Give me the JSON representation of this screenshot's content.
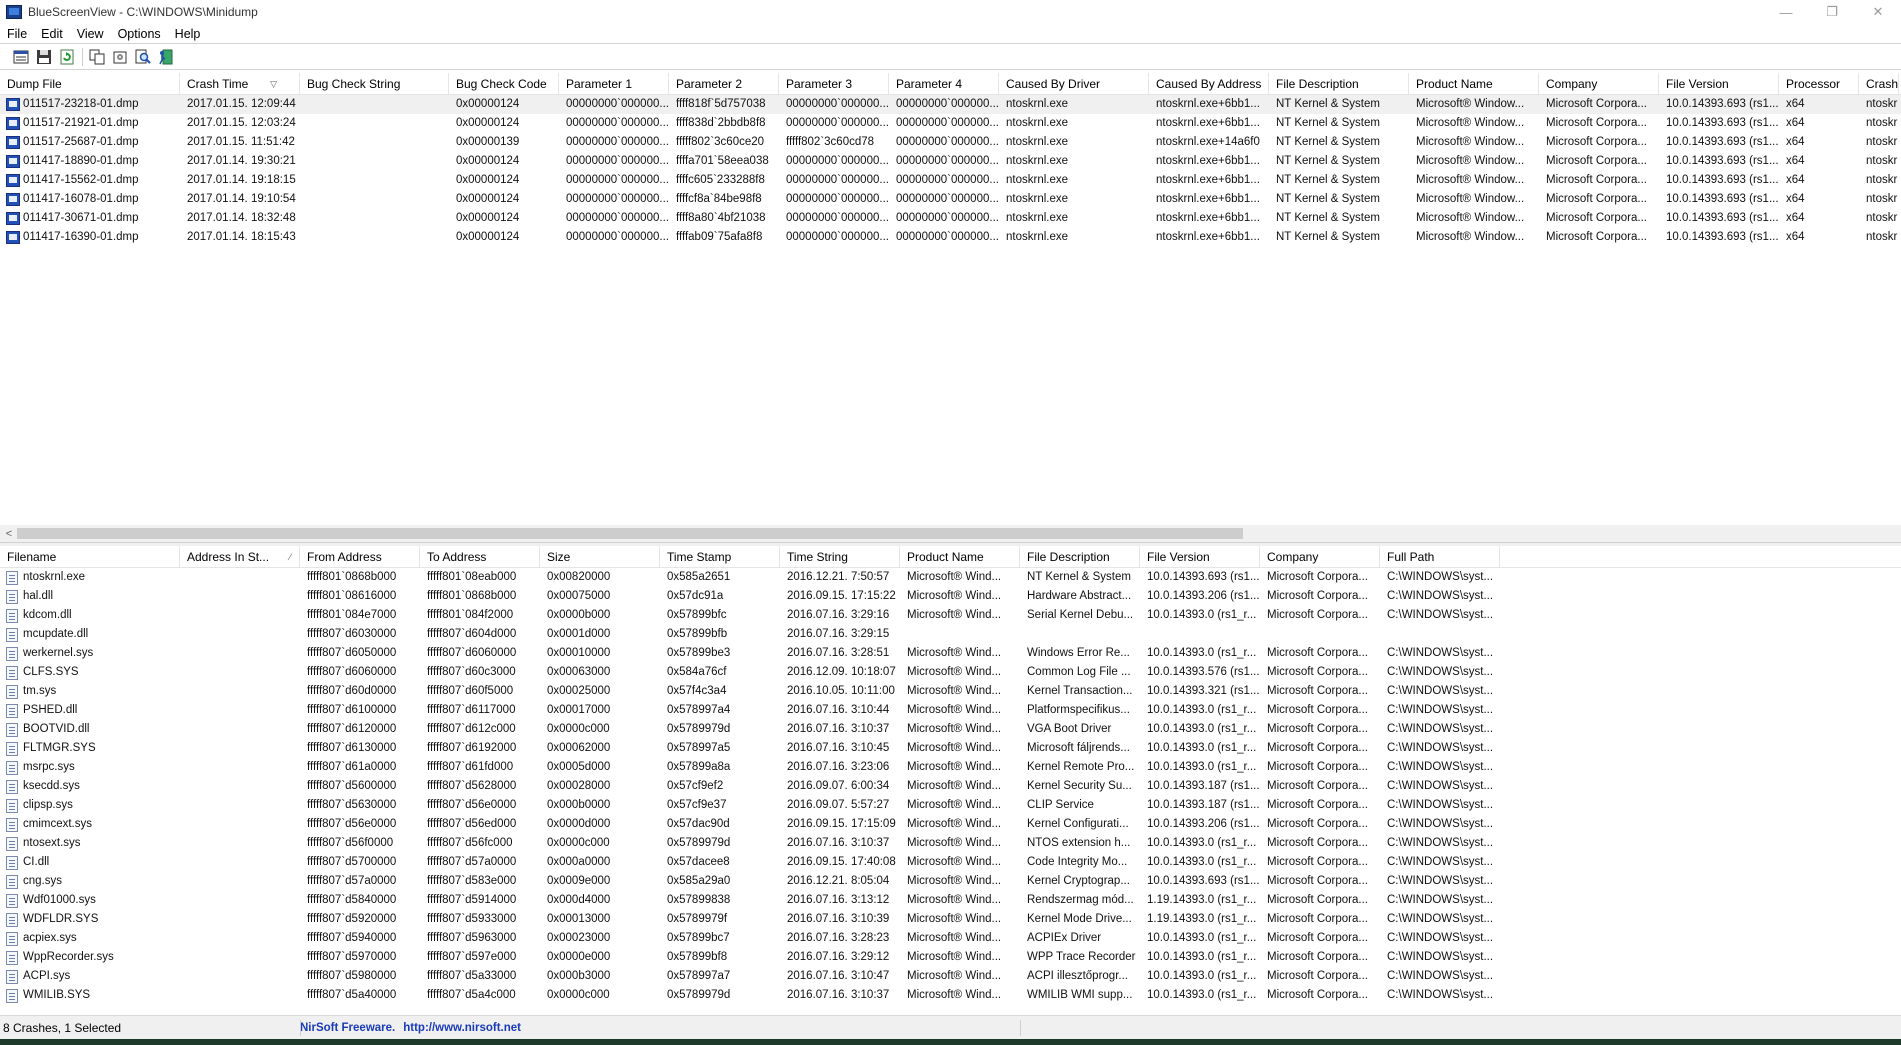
{
  "window": {
    "title": "BlueScreenView  -  C:\\WINDOWS\\Minidump",
    "controls": [
      "—",
      "❐",
      "✕"
    ]
  },
  "menu": [
    "File",
    "Edit",
    "View",
    "Options",
    "Help"
  ],
  "toolbar_icons": [
    "properties-icon",
    "save-icon",
    "refresh-icon",
    "copy-icon",
    "advanced-options-icon",
    "find-icon",
    "exit-icon"
  ],
  "top_table": {
    "columns": [
      "Dump File",
      "Crash Time",
      "Bug Check String",
      "Bug Check Code",
      "Parameter 1",
      "Parameter 2",
      "Parameter 3",
      "Parameter 4",
      "Caused By Driver",
      "Caused By Address",
      "File Description",
      "Product Name",
      "Company",
      "File Version",
      "Processor",
      "Crash"
    ],
    "rows": [
      [
        "011517-23218-01.dmp",
        "2017.01.15. 12:09:44",
        "",
        "0x00000124",
        "00000000`000000...",
        "ffff818f`5d757038",
        "00000000`000000...",
        "00000000`000000...",
        "ntoskrnl.exe",
        "ntoskrnl.exe+6bb1...",
        "NT Kernel & System",
        "Microsoft® Window...",
        "Microsoft Corpora...",
        "10.0.14393.693 (rs1...",
        "x64",
        "ntoskr"
      ],
      [
        "011517-21921-01.dmp",
        "2017.01.15. 12:03:24",
        "",
        "0x00000124",
        "00000000`000000...",
        "ffff838d`2bbdb8f8",
        "00000000`000000...",
        "00000000`000000...",
        "ntoskrnl.exe",
        "ntoskrnl.exe+6bb1...",
        "NT Kernel & System",
        "Microsoft® Window...",
        "Microsoft Corpora...",
        "10.0.14393.693 (rs1...",
        "x64",
        "ntoskr"
      ],
      [
        "011517-25687-01.dmp",
        "2017.01.15. 11:51:42",
        "",
        "0x00000139",
        "00000000`000000...",
        "fffff802`3c60ce20",
        "fffff802`3c60cd78",
        "00000000`000000...",
        "ntoskrnl.exe",
        "ntoskrnl.exe+14a6f0",
        "NT Kernel & System",
        "Microsoft® Window...",
        "Microsoft Corpora...",
        "10.0.14393.693 (rs1...",
        "x64",
        "ntoskr"
      ],
      [
        "011417-18890-01.dmp",
        "2017.01.14. 19:30:21",
        "",
        "0x00000124",
        "00000000`000000...",
        "ffffa701`58eea038",
        "00000000`000000...",
        "00000000`000000...",
        "ntoskrnl.exe",
        "ntoskrnl.exe+6bb1...",
        "NT Kernel & System",
        "Microsoft® Window...",
        "Microsoft Corpora...",
        "10.0.14393.693 (rs1...",
        "x64",
        "ntoskr"
      ],
      [
        "011417-15562-01.dmp",
        "2017.01.14. 19:18:15",
        "",
        "0x00000124",
        "00000000`000000...",
        "ffffc605`233288f8",
        "00000000`000000...",
        "00000000`000000...",
        "ntoskrnl.exe",
        "ntoskrnl.exe+6bb1...",
        "NT Kernel & System",
        "Microsoft® Window...",
        "Microsoft Corpora...",
        "10.0.14393.693 (rs1...",
        "x64",
        "ntoskr"
      ],
      [
        "011417-16078-01.dmp",
        "2017.01.14. 19:10:54",
        "",
        "0x00000124",
        "00000000`000000...",
        "ffffcf8a`84be98f8",
        "00000000`000000...",
        "00000000`000000...",
        "ntoskrnl.exe",
        "ntoskrnl.exe+6bb1...",
        "NT Kernel & System",
        "Microsoft® Window...",
        "Microsoft Corpora...",
        "10.0.14393.693 (rs1...",
        "x64",
        "ntoskr"
      ],
      [
        "011417-30671-01.dmp",
        "2017.01.14. 18:32:48",
        "",
        "0x00000124",
        "00000000`000000...",
        "ffff8a80`4bf21038",
        "00000000`000000...",
        "00000000`000000...",
        "ntoskrnl.exe",
        "ntoskrnl.exe+6bb1...",
        "NT Kernel & System",
        "Microsoft® Window...",
        "Microsoft Corpora...",
        "10.0.14393.693 (rs1...",
        "x64",
        "ntoskr"
      ],
      [
        "011417-16390-01.dmp",
        "2017.01.14. 18:15:43",
        "",
        "0x00000124",
        "00000000`000000...",
        "ffffab09`75afa8f8",
        "00000000`000000...",
        "00000000`000000...",
        "ntoskrnl.exe",
        "ntoskrnl.exe+6bb1...",
        "NT Kernel & System",
        "Microsoft® Window...",
        "Microsoft Corpora...",
        "10.0.14393.693 (rs1...",
        "x64",
        "ntoskr"
      ]
    ]
  },
  "bottom_table": {
    "columns": [
      "Filename",
      "Address In St...",
      "From Address",
      "To Address",
      "Size",
      "Time Stamp",
      "Time String",
      "Product Name",
      "File Description",
      "File Version",
      "Company",
      "Full Path"
    ],
    "rows": [
      [
        "ntoskrnl.exe",
        "",
        "fffff801`0868b000",
        "fffff801`08eab000",
        "0x00820000",
        "0x585a2651",
        "2016.12.21. 7:50:57",
        "Microsoft® Wind...",
        "NT Kernel & System",
        "10.0.14393.693 (rs1...",
        "Microsoft Corpora...",
        "C:\\WINDOWS\\syst..."
      ],
      [
        "hal.dll",
        "",
        "fffff801`08616000",
        "fffff801`0868b000",
        "0x00075000",
        "0x57dc91a",
        "2016.09.15. 17:15:22",
        "Microsoft® Wind...",
        "Hardware Abstract...",
        "10.0.14393.206 (rs1...",
        "Microsoft Corpora...",
        "C:\\WINDOWS\\syst..."
      ],
      [
        "kdcom.dll",
        "",
        "fffff801`084e7000",
        "fffff801`084f2000",
        "0x0000b000",
        "0x57899bfc",
        "2016.07.16. 3:29:16",
        "Microsoft® Wind...",
        "Serial Kernel Debu...",
        "10.0.14393.0 (rs1_r...",
        "Microsoft Corpora...",
        "C:\\WINDOWS\\syst..."
      ],
      [
        "mcupdate.dll",
        "",
        "fffff807`d6030000",
        "fffff807`d604d000",
        "0x0001d000",
        "0x57899bfb",
        "2016.07.16. 3:29:15",
        "",
        "",
        "",
        "",
        ""
      ],
      [
        "werkernel.sys",
        "",
        "fffff807`d6050000",
        "fffff807`d6060000",
        "0x00010000",
        "0x57899be3",
        "2016.07.16. 3:28:51",
        "Microsoft® Wind...",
        "Windows Error Re...",
        "10.0.14393.0 (rs1_r...",
        "Microsoft Corpora...",
        "C:\\WINDOWS\\syst..."
      ],
      [
        "CLFS.SYS",
        "",
        "fffff807`d6060000",
        "fffff807`d60c3000",
        "0x00063000",
        "0x584a76cf",
        "2016.12.09. 10:18:07",
        "Microsoft® Wind...",
        "Common Log File ...",
        "10.0.14393.576 (rs1...",
        "Microsoft Corpora...",
        "C:\\WINDOWS\\syst..."
      ],
      [
        "tm.sys",
        "",
        "fffff807`d60d0000",
        "fffff807`d60f5000",
        "0x00025000",
        "0x57f4c3a4",
        "2016.10.05. 10:11:00",
        "Microsoft® Wind...",
        "Kernel Transaction...",
        "10.0.14393.321 (rs1...",
        "Microsoft Corpora...",
        "C:\\WINDOWS\\syst..."
      ],
      [
        "PSHED.dll",
        "",
        "fffff807`d6100000",
        "fffff807`d6117000",
        "0x00017000",
        "0x578997a4",
        "2016.07.16. 3:10:44",
        "Microsoft® Wind...",
        "Platformspecifikus...",
        "10.0.14393.0 (rs1_r...",
        "Microsoft Corpora...",
        "C:\\WINDOWS\\syst..."
      ],
      [
        "BOOTVID.dll",
        "",
        "fffff807`d6120000",
        "fffff807`d612c000",
        "0x0000c000",
        "0x5789979d",
        "2016.07.16. 3:10:37",
        "Microsoft® Wind...",
        "VGA Boot Driver",
        "10.0.14393.0 (rs1_r...",
        "Microsoft Corpora...",
        "C:\\WINDOWS\\syst..."
      ],
      [
        "FLTMGR.SYS",
        "",
        "fffff807`d6130000",
        "fffff807`d6192000",
        "0x00062000",
        "0x578997a5",
        "2016.07.16. 3:10:45",
        "Microsoft® Wind...",
        "Microsoft fáljrends...",
        "10.0.14393.0 (rs1_r...",
        "Microsoft Corpora...",
        "C:\\WINDOWS\\syst..."
      ],
      [
        "msrpc.sys",
        "",
        "fffff807`d61a0000",
        "fffff807`d61fd000",
        "0x0005d000",
        "0x57899a8a",
        "2016.07.16. 3:23:06",
        "Microsoft® Wind...",
        "Kernel Remote Pro...",
        "10.0.14393.0 (rs1_r...",
        "Microsoft Corpora...",
        "C:\\WINDOWS\\syst..."
      ],
      [
        "ksecdd.sys",
        "",
        "fffff807`d5600000",
        "fffff807`d5628000",
        "0x00028000",
        "0x57cf9ef2",
        "2016.09.07. 6:00:34",
        "Microsoft® Wind...",
        "Kernel Security Su...",
        "10.0.14393.187 (rs1...",
        "Microsoft Corpora...",
        "C:\\WINDOWS\\syst..."
      ],
      [
        "clipsp.sys",
        "",
        "fffff807`d5630000",
        "fffff807`d56e0000",
        "0x000b0000",
        "0x57cf9e37",
        "2016.09.07. 5:57:27",
        "Microsoft® Wind...",
        "CLIP Service",
        "10.0.14393.187 (rs1...",
        "Microsoft Corpora...",
        "C:\\WINDOWS\\syst..."
      ],
      [
        "cmimcext.sys",
        "",
        "fffff807`d56e0000",
        "fffff807`d56ed000",
        "0x0000d000",
        "0x57dac90d",
        "2016.09.15. 17:15:09",
        "Microsoft® Wind...",
        "Kernel Configurati...",
        "10.0.14393.206 (rs1...",
        "Microsoft Corpora...",
        "C:\\WINDOWS\\syst..."
      ],
      [
        "ntosext.sys",
        "",
        "fffff807`d56f0000",
        "fffff807`d56fc000",
        "0x0000c000",
        "0x5789979d",
        "2016.07.16. 3:10:37",
        "Microsoft® Wind...",
        "NTOS extension h...",
        "10.0.14393.0 (rs1_r...",
        "Microsoft Corpora...",
        "C:\\WINDOWS\\syst..."
      ],
      [
        "CI.dll",
        "",
        "fffff807`d5700000",
        "fffff807`d57a0000",
        "0x000a0000",
        "0x57dacee8",
        "2016.09.15. 17:40:08",
        "Microsoft® Wind...",
        "Code Integrity Mo...",
        "10.0.14393.0 (rs1_r...",
        "Microsoft Corpora...",
        "C:\\WINDOWS\\syst..."
      ],
      [
        "cng.sys",
        "",
        "fffff807`d57a0000",
        "fffff807`d583e000",
        "0x0009e000",
        "0x585a29a0",
        "2016.12.21. 8:05:04",
        "Microsoft® Wind...",
        "Kernel Cryptograp...",
        "10.0.14393.693 (rs1...",
        "Microsoft Corpora...",
        "C:\\WINDOWS\\syst..."
      ],
      [
        "Wdf01000.sys",
        "",
        "fffff807`d5840000",
        "fffff807`d5914000",
        "0x000d4000",
        "0x57899838",
        "2016.07.16. 3:13:12",
        "Microsoft® Wind...",
        "Rendszermag mód...",
        "1.19.14393.0 (rs1_r...",
        "Microsoft Corpora...",
        "C:\\WINDOWS\\syst..."
      ],
      [
        "WDFLDR.SYS",
        "",
        "fffff807`d5920000",
        "fffff807`d5933000",
        "0x00013000",
        "0x5789979f",
        "2016.07.16. 3:10:39",
        "Microsoft® Wind...",
        "Kernel Mode Drive...",
        "1.19.14393.0 (rs1_r...",
        "Microsoft Corpora...",
        "C:\\WINDOWS\\syst..."
      ],
      [
        "acpiex.sys",
        "",
        "fffff807`d5940000",
        "fffff807`d5963000",
        "0x00023000",
        "0x57899bc7",
        "2016.07.16. 3:28:23",
        "Microsoft® Wind...",
        "ACPIEx Driver",
        "10.0.14393.0 (rs1_r...",
        "Microsoft Corpora...",
        "C:\\WINDOWS\\syst..."
      ],
      [
        "WppRecorder.sys",
        "",
        "fffff807`d5970000",
        "fffff807`d597e000",
        "0x0000e000",
        "0x57899bf8",
        "2016.07.16. 3:29:12",
        "Microsoft® Wind...",
        "WPP Trace Recorder",
        "10.0.14393.0 (rs1_r...",
        "Microsoft Corpora...",
        "C:\\WINDOWS\\syst..."
      ],
      [
        "ACPI.sys",
        "",
        "fffff807`d5980000",
        "fffff807`d5a33000",
        "0x000b3000",
        "0x578997a7",
        "2016.07.16. 3:10:47",
        "Microsoft® Wind...",
        "ACPI illesztőprogr...",
        "10.0.14393.0 (rs1_r...",
        "Microsoft Corpora...",
        "C:\\WINDOWS\\syst..."
      ],
      [
        "WMILIB.SYS",
        "",
        "fffff807`d5a40000",
        "fffff807`d5a4c000",
        "0x0000c000",
        "0x5789979d",
        "2016.07.16. 3:10:37",
        "Microsoft® Wind...",
        "WMILIB WMI supp...",
        "10.0.14393.0 (rs1_r...",
        "Microsoft Corpora...",
        "C:\\WINDOWS\\syst..."
      ]
    ]
  },
  "status": {
    "count": "8 Crashes, 1 Selected",
    "freeware": "NirSoft Freeware.",
    "url": "http://www.nirsoft.net"
  }
}
